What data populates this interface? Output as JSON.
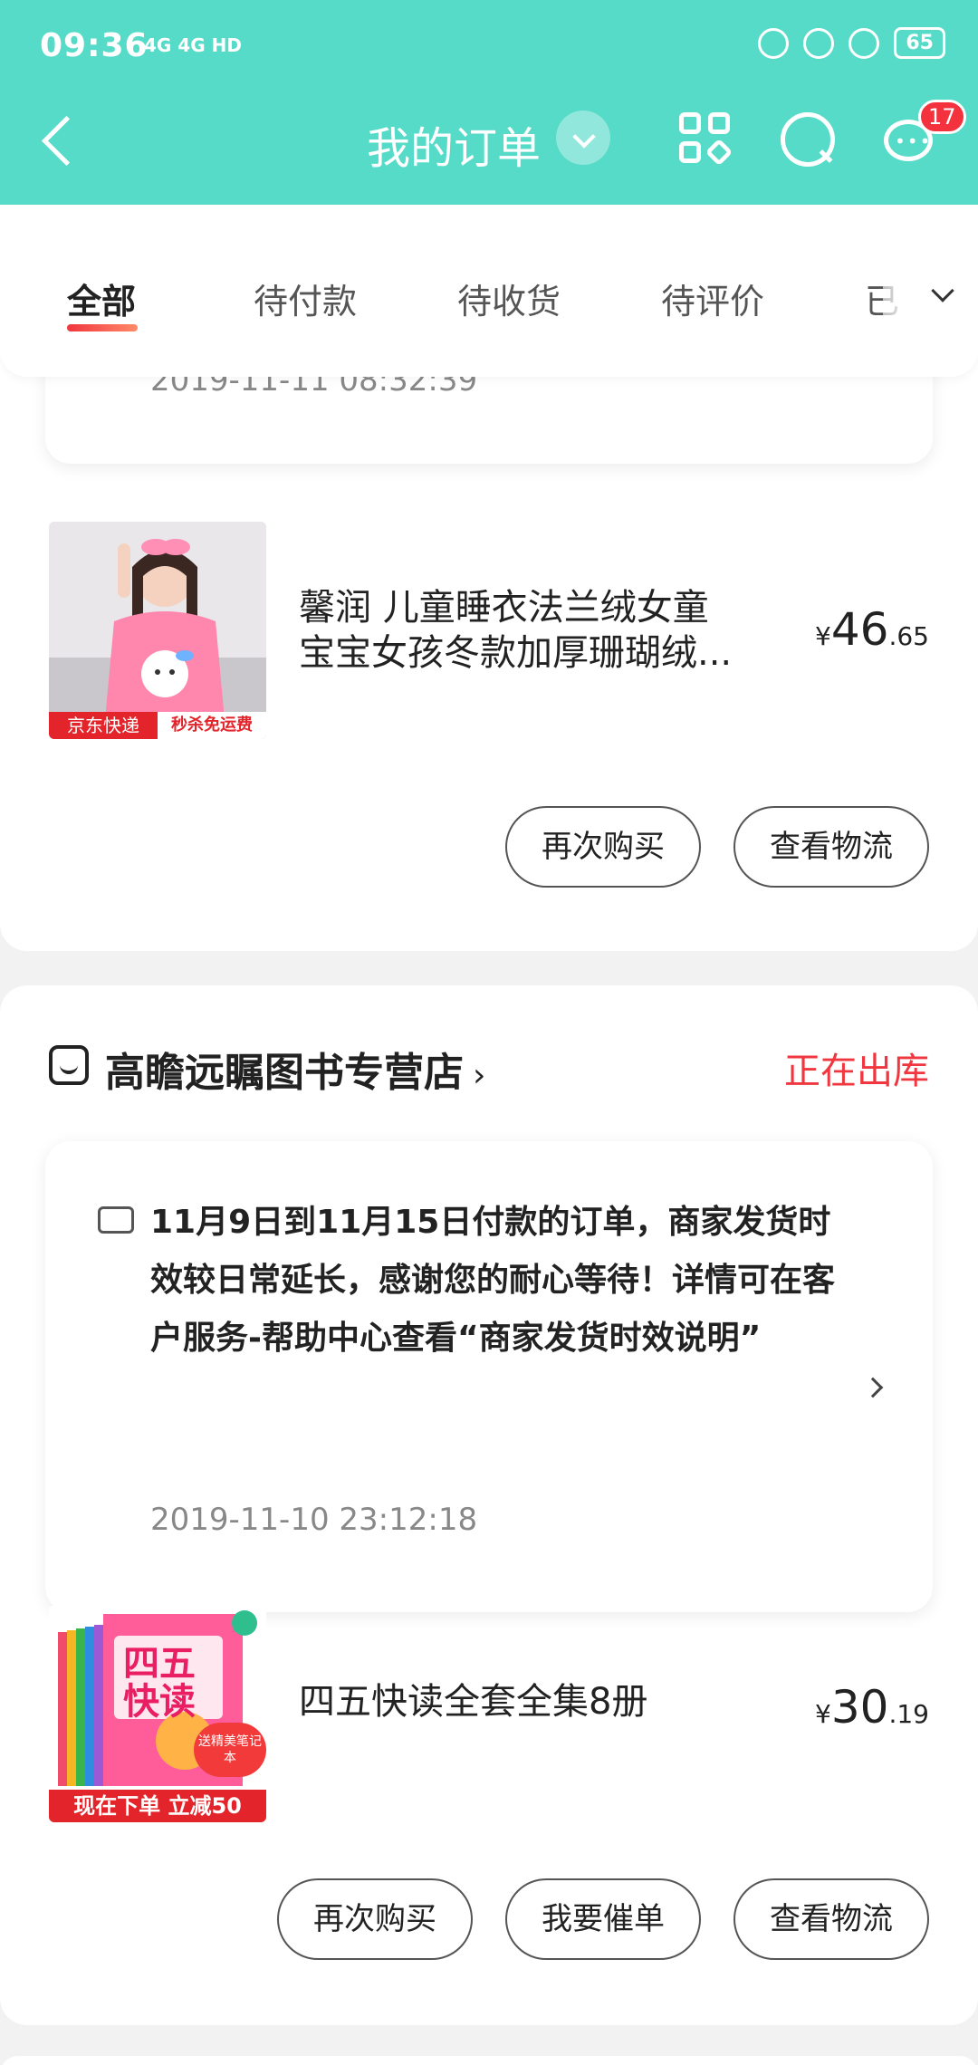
{
  "status_bar": {
    "time": "09:36",
    "network": "4G 4G HD",
    "battery": "65"
  },
  "header": {
    "title": "我的订单",
    "message_badge": "17"
  },
  "tabs": [
    {
      "label": "全部",
      "active": true
    },
    {
      "label": "待付款"
    },
    {
      "label": "待收货"
    },
    {
      "label": "待评价"
    },
    {
      "label": "已"
    }
  ],
  "order1": {
    "notice_time": "2019-11-11 08:32:39",
    "product": {
      "name": "馨润 儿童睡衣法兰绒女童宝宝女孩冬款加厚珊瑚绒...",
      "img_tag_left": "京东快递",
      "img_tag_right": "秒杀免运费",
      "price_symbol": "¥",
      "price_int": "46",
      "price_dec": ".65"
    },
    "buttons": [
      "再次购买",
      "查看物流"
    ]
  },
  "order2": {
    "store": "高瞻远瞩图书专营店",
    "store_arrow": "›",
    "status": "正在出库",
    "notice_text": "11月9日到11月15日付款的订单，商家发货时效较日常延长，感谢您的耐心等待！详情可在客户服务-帮助中心查看“商家发货时效说明”",
    "notice_time": "2019-11-10 23:12:18",
    "product": {
      "name": "四五快读全套全集8册",
      "img_title": "四五快读",
      "img_gift": "送精美笔记本",
      "img_banner": "现在下单 立减50",
      "price_symbol": "¥",
      "price_int": "30",
      "price_dec": ".19"
    },
    "buttons": [
      "再次购买",
      "我要催单",
      "查看物流"
    ]
  },
  "colors": {
    "header": "#56dbc8",
    "accent_red": "#f0363e"
  }
}
